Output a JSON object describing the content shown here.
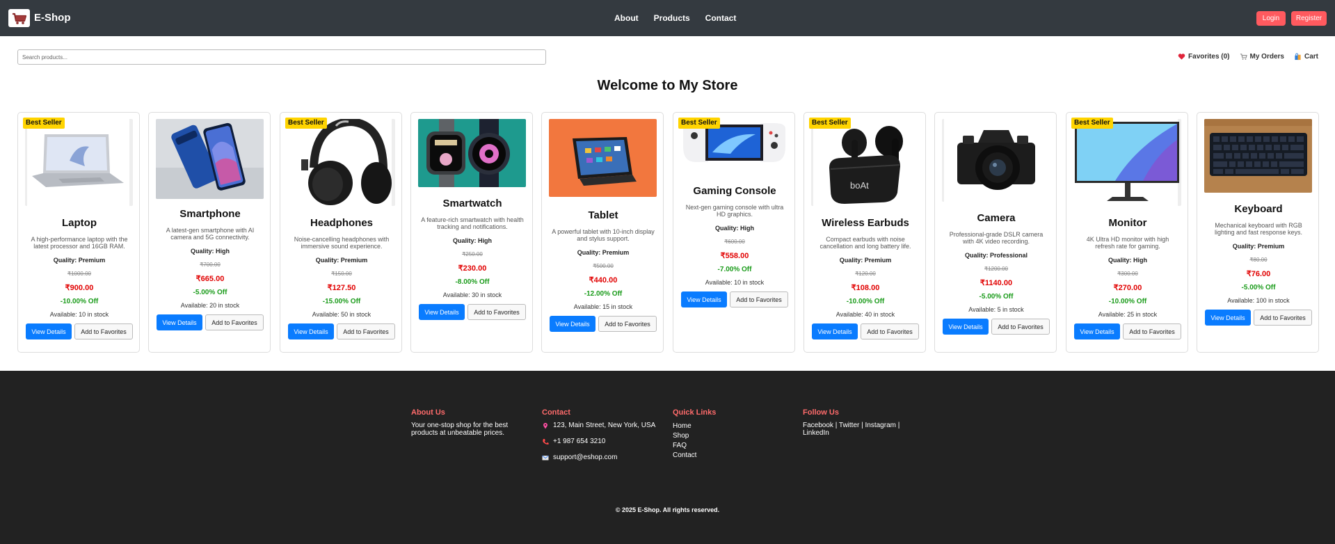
{
  "header": {
    "brand": "E-Shop",
    "nav": [
      "About",
      "Products",
      "Contact"
    ],
    "login": "Login",
    "register": "Register"
  },
  "search": {
    "placeholder": "Search products..."
  },
  "top_links": {
    "favorites": "Favorites (0)",
    "orders": "My Orders",
    "cart": "Cart"
  },
  "page_title": "Welcome to My Store",
  "colors": {
    "navbar": "#343a40",
    "accent": "#ff5a5f",
    "primary_button": "#0a7cff",
    "badge": "#ffd400",
    "price": "#e10000",
    "discount": "#1a9b1a",
    "footer": "#222222",
    "footer_heading": "#ff6b6b"
  },
  "products": [
    {
      "name": "Laptop",
      "image_icon": "laptop-image",
      "badge": "Best Seller",
      "desc": "A high-performance laptop with the latest processor and 16GB RAM.",
      "quality": "Quality: Premium",
      "original_price": "₹1000.00",
      "price": "₹900.00",
      "discount": "-10.00% Off",
      "stock": "Available: 10 in stock",
      "view": "View Details",
      "fav": "Add to Favorites"
    },
    {
      "name": "Smartphone",
      "image_icon": "smartphone-image",
      "badge": "",
      "desc": "A latest-gen smartphone with AI camera and 5G connectivity.",
      "quality": "Quality: High",
      "original_price": "₹700.00",
      "price": "₹665.00",
      "discount": "-5.00% Off",
      "stock": "Available: 20 in stock",
      "view": "View Details",
      "fav": "Add to Favorites"
    },
    {
      "name": "Headphones",
      "image_icon": "headphones-image",
      "badge": "Best Seller",
      "desc": "Noise-cancelling headphones with immersive sound experience.",
      "quality": "Quality: Premium",
      "original_price": "₹150.00",
      "price": "₹127.50",
      "discount": "-15.00% Off",
      "stock": "Available: 50 in stock",
      "view": "View Details",
      "fav": "Add to Favorites"
    },
    {
      "name": "Smartwatch",
      "image_icon": "smartwatch-image",
      "badge": "",
      "desc": "A feature-rich smartwatch with health tracking and notifications.",
      "quality": "Quality: High",
      "original_price": "₹250.00",
      "price": "₹230.00",
      "discount": "-8.00% Off",
      "stock": "Available: 30 in stock",
      "view": "View Details",
      "fav": "Add to Favorites"
    },
    {
      "name": "Tablet",
      "image_icon": "tablet-image",
      "badge": "",
      "desc": "A powerful tablet with 10-inch display and stylus support.",
      "quality": "Quality: Premium",
      "original_price": "₹500.00",
      "price": "₹440.00",
      "discount": "-12.00% Off",
      "stock": "Available: 15 in stock",
      "view": "View Details",
      "fav": "Add to Favorites"
    },
    {
      "name": "Gaming Console",
      "image_icon": "gaming-console-image",
      "badge": "Best Seller",
      "desc": "Next-gen gaming console with ultra HD graphics.",
      "quality": "Quality: High",
      "original_price": "₹600.00",
      "price": "₹558.00",
      "discount": "-7.00% Off",
      "stock": "Available: 10 in stock",
      "view": "View Details",
      "fav": "Add to Favorites"
    },
    {
      "name": "Wireless Earbuds",
      "image_icon": "earbuds-image",
      "badge": "Best Seller",
      "desc": "Compact earbuds with noise cancellation and long battery life.",
      "quality": "Quality: Premium",
      "original_price": "₹120.00",
      "price": "₹108.00",
      "discount": "-10.00% Off",
      "stock": "Available: 40 in stock",
      "view": "View Details",
      "fav": "Add to Favorites"
    },
    {
      "name": "Camera",
      "image_icon": "camera-image",
      "badge": "",
      "desc": "Professional-grade DSLR camera with 4K video recording.",
      "quality": "Quality: Professional",
      "original_price": "₹1200.00",
      "price": "₹1140.00",
      "discount": "-5.00% Off",
      "stock": "Available: 5 in stock",
      "view": "View Details",
      "fav": "Add to Favorites"
    },
    {
      "name": "Monitor",
      "image_icon": "monitor-image",
      "badge": "Best Seller",
      "desc": "4K Ultra HD monitor with high refresh rate for gaming.",
      "quality": "Quality: High",
      "original_price": "₹300.00",
      "price": "₹270.00",
      "discount": "-10.00% Off",
      "stock": "Available: 25 in stock",
      "view": "View Details",
      "fav": "Add to Favorites"
    },
    {
      "name": "Keyboard",
      "image_icon": "keyboard-image",
      "badge": "",
      "desc": "Mechanical keyboard with RGB lighting and fast response keys.",
      "quality": "Quality: Premium",
      "original_price": "₹80.00",
      "price": "₹76.00",
      "discount": "-5.00% Off",
      "stock": "Available: 100 in stock",
      "view": "View Details",
      "fav": "Add to Favorites"
    }
  ],
  "footer": {
    "about_title": "About Us",
    "about_text": "Your one-stop shop for the best products at unbeatable prices.",
    "contact_title": "Contact",
    "address": "123, Main Street, New York, USA",
    "phone": "+1 987 654 3210",
    "email": "support@eshop.com",
    "quick_title": "Quick Links",
    "quick_links": [
      "Home",
      "Shop",
      "FAQ",
      "Contact"
    ],
    "follow_title": "Follow Us",
    "social": "Facebook | Twitter | Instagram | LinkedIn",
    "copyright": "© 2025 E-Shop. All rights reserved."
  }
}
